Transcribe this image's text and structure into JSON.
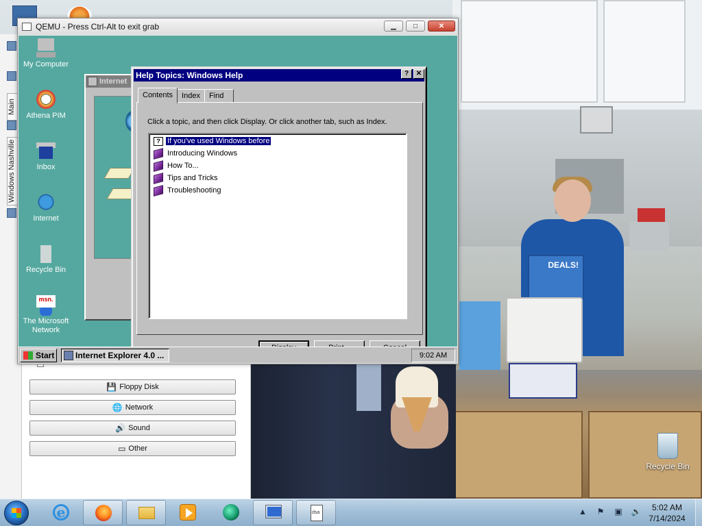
{
  "qemu": {
    "title": "QEMU - Press Ctrl-Alt to exit grab",
    "controls": {
      "minimize": "▁",
      "maximize": "□",
      "close": "✕"
    }
  },
  "guest": {
    "desktop_icons": [
      {
        "label": "My Computer",
        "icon": "computer-icon"
      },
      {
        "label": "Athena PIM",
        "icon": "athena-pim-icon"
      },
      {
        "label": "Inbox",
        "icon": "inbox-icon"
      },
      {
        "label": "Internet",
        "icon": "internet-icon"
      },
      {
        "label": "Recycle Bin",
        "icon": "recycle-bin-icon"
      },
      {
        "label": "The Microsoft Network",
        "icon": "msn-icon",
        "logo_text": "msn."
      }
    ],
    "bg_window_title": "Internet",
    "help": {
      "title": "Help Topics: Windows Help",
      "help_btn": "?",
      "close_btn": "✕",
      "tabs": [
        "Contents",
        "Index",
        "Find"
      ],
      "active_tab": "Contents",
      "instructions": "Click a topic, and then click Display. Or click another tab, such as Index.",
      "topics": [
        {
          "label": "If you've used Windows before",
          "icon": "question-page-icon",
          "selected": true
        },
        {
          "label": "Introducing Windows",
          "icon": "book-icon"
        },
        {
          "label": "How To...",
          "icon": "book-icon"
        },
        {
          "label": "Tips and Tricks",
          "icon": "book-icon"
        },
        {
          "label": "Troubleshooting",
          "icon": "book-icon"
        }
      ],
      "buttons": {
        "display": "Display",
        "print": "Print...",
        "cancel": "Cancel"
      }
    },
    "taskbar": {
      "start": "Start",
      "task_button": "Internet Explorer 4.0 ...",
      "clock": "9:02 AM"
    }
  },
  "host": {
    "side_tabs": [
      "Main",
      "Windows Nashville"
    ],
    "sign_text": "DEALS!",
    "side_buttons": [
      {
        "label": "Floppy Disk",
        "glyph": "💾"
      },
      {
        "label": "Network",
        "glyph": "🌐"
      },
      {
        "label": "Sound",
        "glyph": "🔊"
      },
      {
        "label": "Other",
        "glyph": "▭"
      }
    ],
    "recycle_bin": "Recycle Bin",
    "taskbar": {
      "time": "5:02 AM",
      "date": "7/14/2024",
      "tray": [
        "▲",
        "⚑",
        "▣",
        "🔈"
      ],
      "doc_label": "dsa"
    }
  }
}
